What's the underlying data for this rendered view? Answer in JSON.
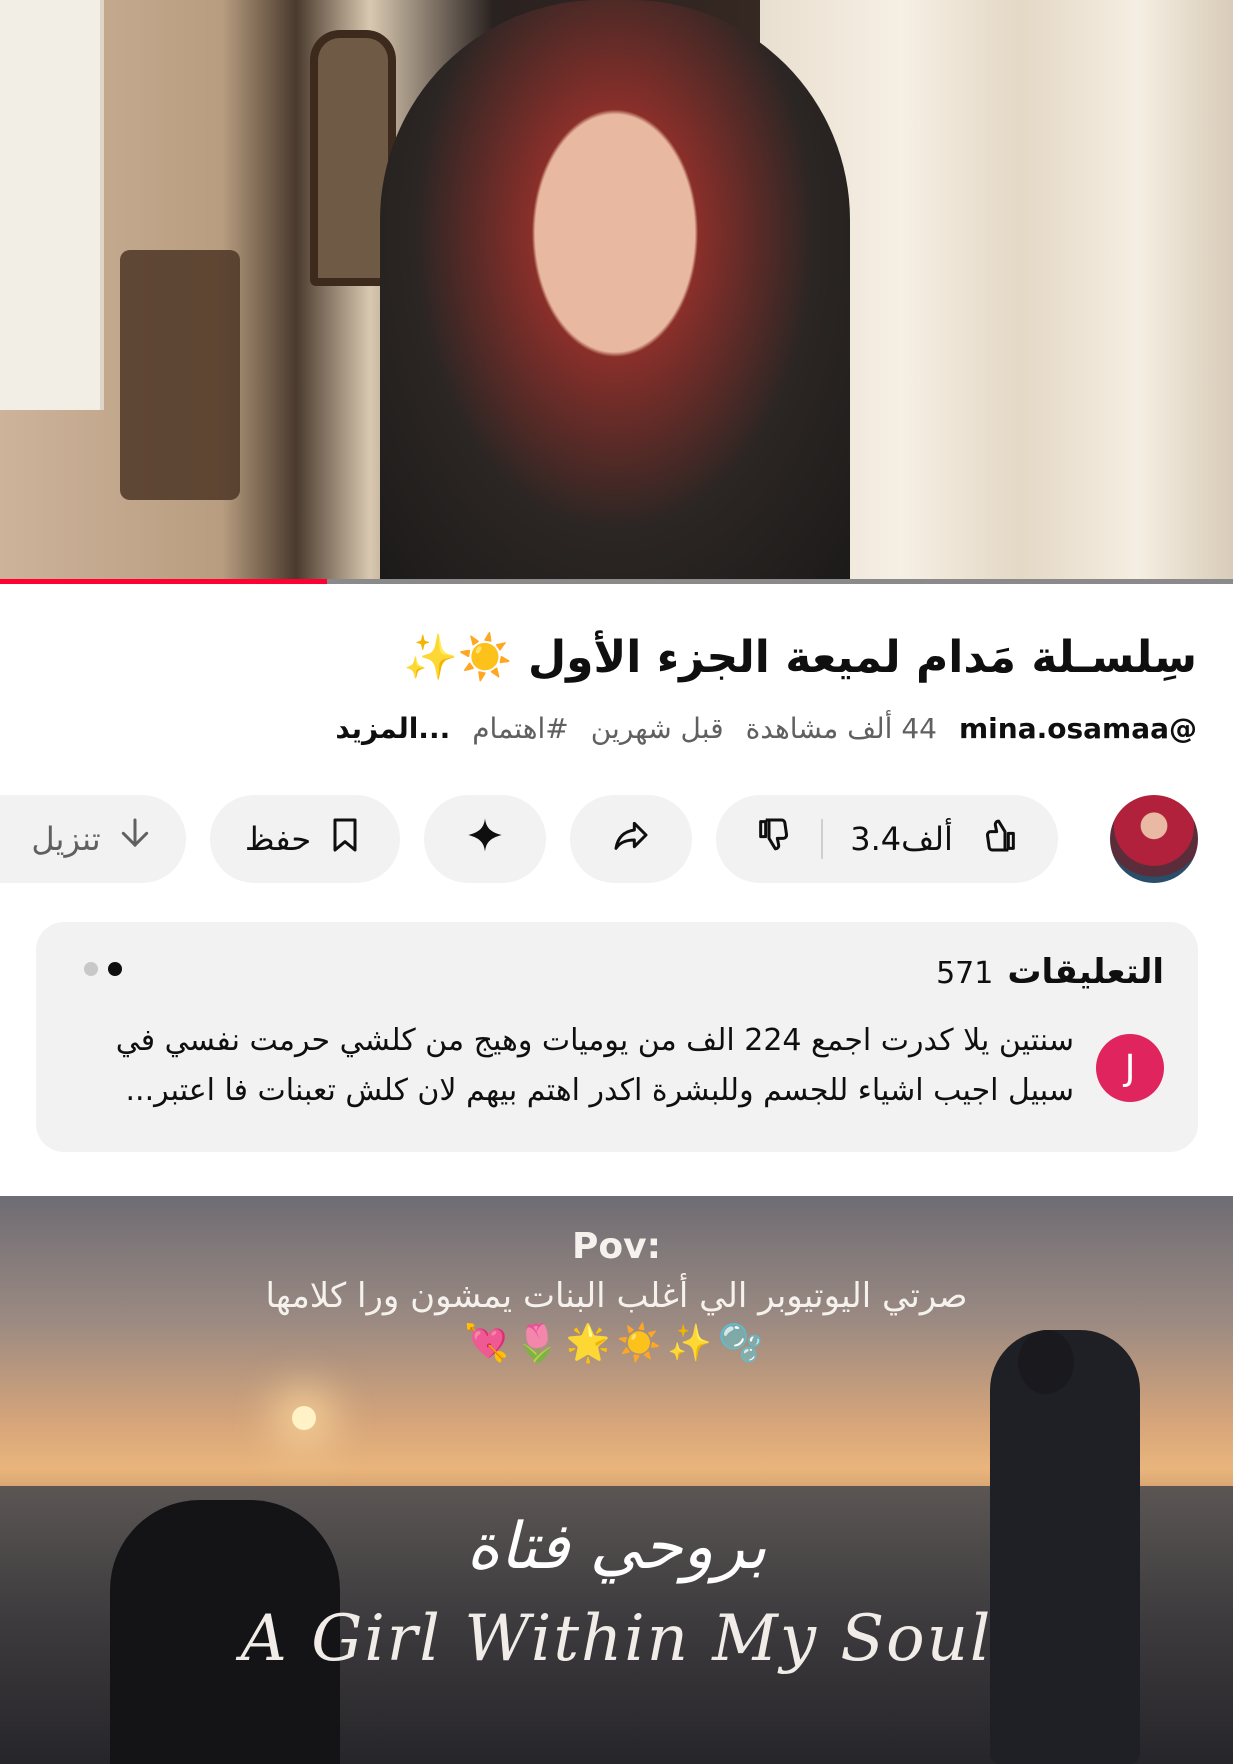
{
  "video": {
    "progress_fraction": 0.265
  },
  "title": "سِلسـلة مَدام لميعة الجزء الأول ☀️✨",
  "meta": {
    "handle": "@mina.osamaa",
    "views": "44 ألف مشاهدة",
    "time": "قبل شهرين",
    "hashtag": "#اهتمام",
    "more": "...المزيد"
  },
  "actions": {
    "like_count": "3.4ألف",
    "save_label": "حفظ",
    "download_label": "تنزيل"
  },
  "icons": {
    "like": "thumb-up-icon",
    "dislike": "thumb-down-icon",
    "share": "share-icon",
    "spark": "sparkle-icon",
    "save": "bookmark-icon",
    "download": "download-icon"
  },
  "comments": {
    "title": "التعليقات",
    "count": "571",
    "avatar_letter": "J",
    "text": "سنتين يلا كدرت اجمع 224 الف من يوميات وهيج من كلشي حرمت نفسي في سبيل اجيب اشياء للجسم وللبشرة اكدر اهتم بيهم لان كلش تعبنات فا اعتبر..."
  },
  "next_video": {
    "pov_title": "Pov:",
    "pov_line": "صرتي اليوتيوبر الي أغلب البنات يمشون ورا كلامها",
    "pov_emoji": "💘🌷🌟☀️✨🫧",
    "song_ar": "بروحي فتاة",
    "song_en": "A Girl Within My Soul"
  },
  "colors": {
    "accent": "#ff0033",
    "pill_bg": "#f2f2f2",
    "comment_avatar": "#e0245e"
  }
}
